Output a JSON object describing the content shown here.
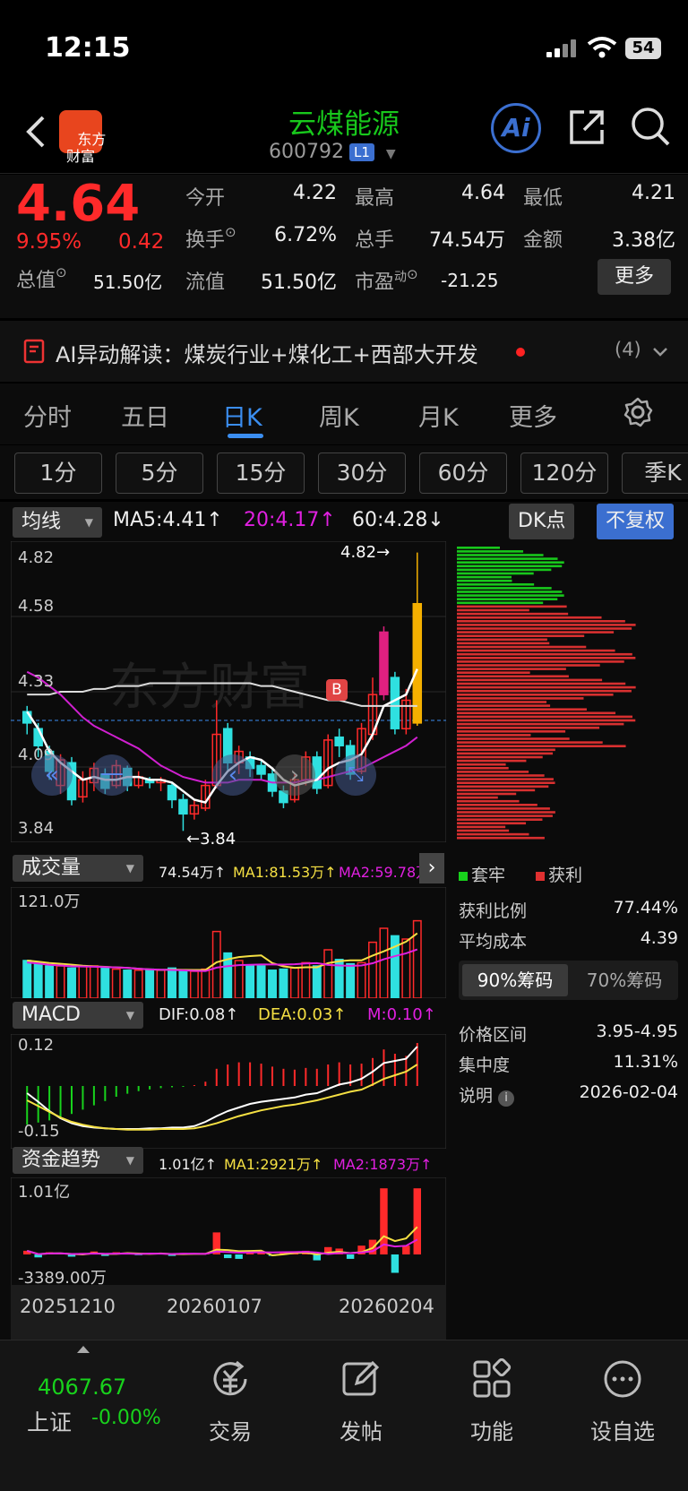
{
  "status": {
    "time": "12:15",
    "battery": "54"
  },
  "header": {
    "logo_text": "东方\n财富",
    "title": "云煤能源",
    "code": "600792",
    "level": "L1",
    "ai_label": "Ai"
  },
  "quote": {
    "price": "4.64",
    "change_pct": "9.95%",
    "change": "0.42",
    "open_label": "今开",
    "open": "4.22",
    "high_label": "最高",
    "high": "4.64",
    "low_label": "最低",
    "low": "4.21",
    "turnover_label": "换手",
    "turnover": "6.72%",
    "volume_label": "总手",
    "volume": "74.54万",
    "amount_label": "金额",
    "amount": "3.38亿",
    "mktcap_label": "总值",
    "mktcap": "51.50亿",
    "float_label": "流值",
    "float": "51.50亿",
    "pe_label": "市盈",
    "pe_sup": "动",
    "pe": "-21.25",
    "more": "更多"
  },
  "ai_banner": {
    "text": "AI异动解读：煤炭行业+煤化工+西部大开发",
    "count": "(4)"
  },
  "tabs": [
    "分时",
    "五日",
    "日K",
    "周K",
    "月K",
    "更多"
  ],
  "active_tab": 2,
  "period_tabs": [
    "1分",
    "5分",
    "15分",
    "30分",
    "60分",
    "120分",
    "季K"
  ],
  "main_chart": {
    "indicator": "均线",
    "ma5": "MA5:4.41↑",
    "ma20": "20:4.17↑",
    "ma60": "60:4.28↓",
    "dk": "DK点",
    "fq": "不复权",
    "y_labels": [
      "4.82",
      "4.58",
      "4.33",
      "4.09",
      "3.84"
    ],
    "high_mark": "4.82→",
    "low_mark": "←3.84",
    "b_mark": "B",
    "watermark": "东方财富"
  },
  "volume_chart": {
    "indicator": "成交量",
    "v": "74.54万↑",
    "ma1": "MA1:81.53万↑",
    "ma2": "MA2:59.78万↑",
    "y_top": "121.0万"
  },
  "macd_chart": {
    "indicator": "MACD",
    "dif": "DIF:0.08↑",
    "dea": "DEA:0.03↑",
    "m": "M:0.10↑",
    "y_top": "0.12",
    "y_bottom": "-0.15"
  },
  "fund_chart": {
    "indicator": "资金趋势",
    "v": "1.01亿↑",
    "ma1": "MA1:2921万↑",
    "ma2": "MA2:1873万↑",
    "y_top": "1.01亿",
    "y_bottom": "-3389.00万"
  },
  "x_labels": [
    "20251210",
    "20260107",
    "20260204"
  ],
  "chips": {
    "legend_trap": "套牢",
    "legend_profit": "获利",
    "profit_ratio_label": "获利比例",
    "profit_ratio": "77.44%",
    "avg_cost_label": "平均成本",
    "avg_cost": "4.39",
    "tab90": "90%筹码",
    "tab70": "70%筹码",
    "range_label": "价格区间",
    "range": "3.95-4.95",
    "concentration_label": "集中度",
    "concentration": "11.31%",
    "note_label": "说明",
    "date": "2026-02-04"
  },
  "nav": {
    "index_value": "4067.67",
    "index_name": "上证",
    "index_change": "-0.00%",
    "items": [
      "交易",
      "发帖",
      "功能",
      "设自选"
    ]
  },
  "colors": {
    "up": "#ff2a2a",
    "down": "#2fe0e0",
    "green": "#18d21c",
    "accent": "#3b6fd0"
  }
}
